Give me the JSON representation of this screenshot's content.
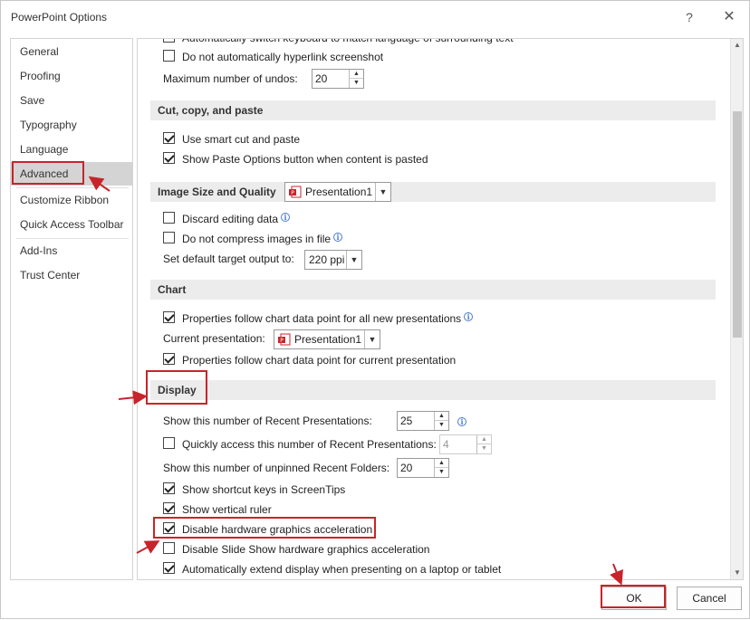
{
  "window": {
    "title": "PowerPoint Options",
    "help": "?",
    "close": "✕"
  },
  "sidebar": {
    "items": [
      {
        "label": "General"
      },
      {
        "label": "Proofing"
      },
      {
        "label": "Save"
      },
      {
        "label": "Typography"
      },
      {
        "label": "Language"
      },
      {
        "label": "Advanced",
        "selected": true
      },
      {
        "label": "Customize Ribbon"
      },
      {
        "label": "Quick Access Toolbar"
      },
      {
        "label": "Add-Ins"
      },
      {
        "label": "Trust Center"
      }
    ]
  },
  "editing": {
    "partial_row": "Automatically switch keyboard to match language of surrounding text",
    "no_hyperlink_screenshot": "Do not automatically hyperlink screenshot",
    "max_undos_label": "Maximum number of undos:",
    "max_undos_value": "20"
  },
  "cut_copy_paste": {
    "header": "Cut, copy, and paste",
    "smart_cut": "Use smart cut and paste",
    "paste_options": "Show Paste Options button when content is pasted"
  },
  "image": {
    "header": "Image Size and Quality",
    "presentation": "Presentation1",
    "discard_editing": "Discard editing data",
    "no_compress": "Do not compress images in file",
    "target_output_label": "Set default target output to:",
    "target_output_value": "220 ppi"
  },
  "chart": {
    "header": "Chart",
    "follow_all_new": "Properties follow chart data point for all new presentations",
    "current_presentation_label": "Current presentation:",
    "current_presentation_value": "Presentation1",
    "follow_current": "Properties follow chart data point for current presentation"
  },
  "display": {
    "header": "Display",
    "recent_presentations_label": "Show this number of Recent Presentations:",
    "recent_presentations_value": "25",
    "quick_access_label": "Quickly access this number of Recent Presentations:",
    "quick_access_value": "4",
    "unpinned_folders_label": "Show this number of unpinned Recent Folders:",
    "unpinned_folders_value": "20",
    "shortcut_keys": "Show shortcut keys in ScreenTips",
    "vertical_ruler": "Show vertical ruler",
    "disable_hw_accel": "Disable hardware graphics acceleration",
    "disable_slideshow_hw": "Disable Slide Show hardware graphics acceleration",
    "auto_extend": "Automatically extend display when presenting on a laptop or tablet"
  },
  "buttons": {
    "ok": "OK",
    "cancel": "Cancel"
  },
  "colors": {
    "highlight": "#c8242b",
    "selected_nav": "#d4d4d4",
    "section_header": "#ececec"
  }
}
